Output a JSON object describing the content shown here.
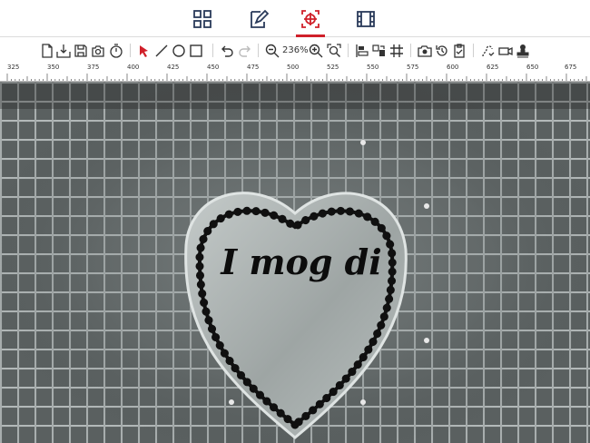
{
  "nav": {
    "tabs": [
      {
        "name": "grid-view",
        "icon": "grid-icon",
        "active": false
      },
      {
        "name": "edit",
        "icon": "edit-document-icon",
        "active": false
      },
      {
        "name": "target",
        "icon": "crosshair-target-icon",
        "active": true
      },
      {
        "name": "film",
        "icon": "film-strip-icon",
        "active": false
      }
    ],
    "accent_color": "#d0202a"
  },
  "toolbar": {
    "zoom_label": "236%",
    "icons": [
      "new-file-icon",
      "import-icon",
      "save-icon",
      "camera-save-icon",
      "timer-icon",
      "select-arrow-icon",
      "line-icon",
      "ellipse-icon",
      "rectangle-icon",
      "undo-icon",
      "redo-icon",
      "zoom-out-icon",
      "zoom-in-icon",
      "zoom-fit-icon",
      "align-icon",
      "arrange-icon",
      "grid-icon",
      "camera-icon",
      "history-icon",
      "checklist-icon",
      "trace-icon",
      "laser-icon",
      "stamp-icon"
    ]
  },
  "ruler": {
    "labels": [
      "325",
      "350",
      "375",
      "400",
      "425",
      "450",
      "475",
      "500",
      "525",
      "550",
      "575",
      "600",
      "625",
      "650",
      "675"
    ]
  },
  "design": {
    "text": "I mog di"
  }
}
